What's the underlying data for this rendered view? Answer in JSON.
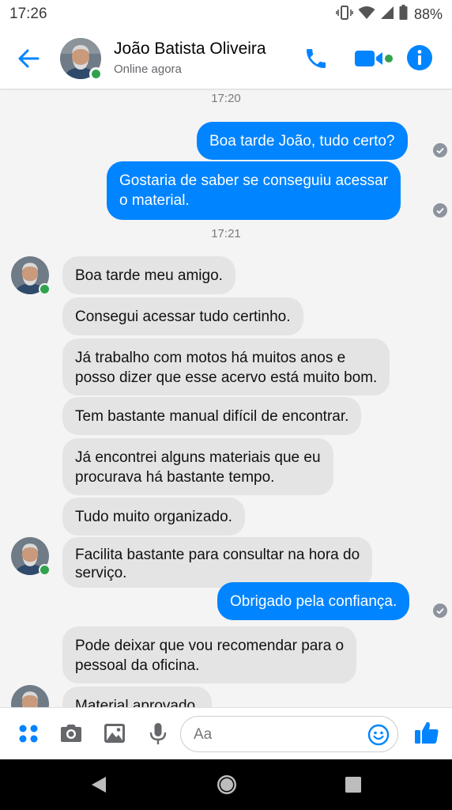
{
  "status_bar": {
    "time": "17:26",
    "battery": "88%",
    "icons": [
      "vibrate-icon",
      "wifi-icon",
      "signal-icon",
      "battery-icon"
    ]
  },
  "header": {
    "contact_name": "João Batista Oliveira",
    "status": "Online agora",
    "icons": [
      "back-arrow-icon",
      "phone-icon",
      "video-camera-icon",
      "info-icon"
    ],
    "accent_color": "#0084ff",
    "online_color": "#31a24c"
  },
  "chat": {
    "timestamps": [
      "17:20",
      "17:21"
    ],
    "messages": [
      {
        "dir": "out",
        "text": "Boa tarde João, tudo certo?"
      },
      {
        "dir": "out",
        "text": "Gostaria de saber se conseguiu acessar",
        "text2": "o material."
      },
      {
        "dir": "in",
        "text": "Boa tarde meu amigo."
      },
      {
        "dir": "in",
        "text": "Consegui acessar tudo certinho."
      },
      {
        "dir": "in",
        "text": "Já trabalho com motos há muitos anos e",
        "text2": "posso dizer que esse acervo está muito bom."
      },
      {
        "dir": "in",
        "text": "Tem bastante manual difícil de encontrar."
      },
      {
        "dir": "in",
        "text": "Já encontrei alguns materiais que eu",
        "text2": "procurava há bastante tempo."
      },
      {
        "dir": "in",
        "text": "Tudo muito organizado."
      },
      {
        "dir": "in",
        "text": "Facilita bastante para consultar na hora do",
        "text2": "serviço."
      },
      {
        "dir": "out",
        "text": "Obrigado pela confiança."
      },
      {
        "dir": "in",
        "text": "Pode deixar que vou recomendar para o",
        "text2": "pessoal da oficina."
      },
      {
        "dir": "in",
        "text": "Material aprovado."
      }
    ]
  },
  "composer": {
    "placeholder": "Aa",
    "icons": [
      "apps-grid-icon",
      "camera-icon",
      "image-icon",
      "microphone-icon",
      "emoji-icon",
      "thumbs-up-icon"
    ]
  },
  "nav_bar": {
    "icons": [
      "nav-back-icon",
      "nav-home-icon",
      "nav-recents-icon"
    ]
  }
}
